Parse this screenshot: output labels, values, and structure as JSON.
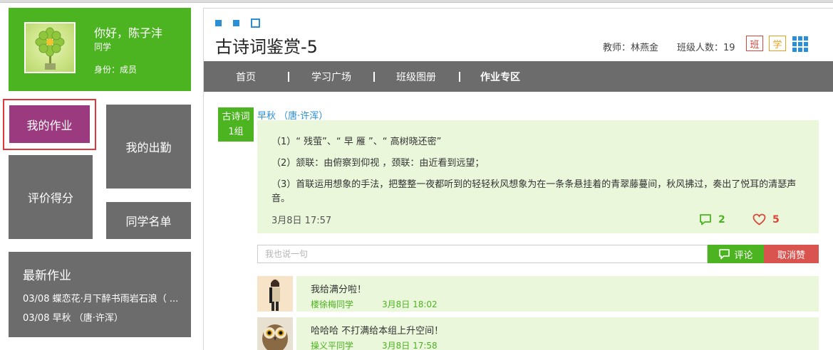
{
  "user": {
    "greeting": "你好，陈子沣",
    "role": "同学",
    "identity": "身份：成员"
  },
  "menu": {
    "my_homework": "我的作业",
    "my_attendance": "我的出勤",
    "evaluation": "评价得分",
    "classmates": "同学名单"
  },
  "latest": {
    "title": "最新作业",
    "items": [
      "03/08 蝶恋花·月下醉书雨岩石浪（ ...",
      "03/08 早秋 （唐·许浑）"
    ]
  },
  "course": {
    "title": "古诗词鉴赏-5",
    "teacher": "教师：林燕金",
    "class_size": "班级人数：19",
    "badge_class": "班",
    "badge_study": "学"
  },
  "nav": {
    "items": [
      "首页",
      "学习广场",
      "班级图册",
      "作业专区"
    ],
    "active_index": 3
  },
  "post": {
    "group_line1": "古诗词",
    "group_line2": "1组",
    "title": "早秋 （唐·许浑）",
    "lines": [
      "（1）“ 残萤”、“ 早 雁 ”、“ 高树晓还密”",
      "（2）颔联：由俯察到仰视 ，颈联：由近看到远望；",
      "（3）首联运用想象的手法，把整整一夜都听到的轻轻秋风想象为在一条条悬挂着的青翠藤蔓间，秋风拂过，奏出了悦耳的清瑟声音。"
    ],
    "time": "3月8日 17:57",
    "comment_count": "2",
    "like_count": "5"
  },
  "comment_form": {
    "placeholder": "我也说一句",
    "submit_label": "评论",
    "unlike_label": "取消赞"
  },
  "replies": [
    {
      "text": "我给满分啦！",
      "user": "楼徐梅同学",
      "time": "3月8日 18:02"
    },
    {
      "text": "哈哈哈 不打满给本组上升空间！",
      "user": "操义平同学",
      "time": "3月8日 17:58"
    }
  ],
  "colors": {
    "green": "#4cb321",
    "gray": "#6c6c6c",
    "purple": "#9b3a7e",
    "red": "#d9473a",
    "blue": "#2b8fd6",
    "light_green": "#eaf7db"
  },
  "icons": {
    "avatar": "flower-avatar-icon",
    "comment": "speech-bubble-icon",
    "like": "heart-icon",
    "apps": "grid-icon"
  }
}
